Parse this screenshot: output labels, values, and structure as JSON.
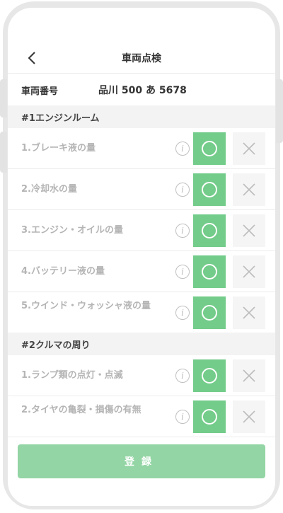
{
  "header": {
    "title": "車両点検"
  },
  "vehicle": {
    "label": "車両番号",
    "value": "品川 500 あ 5678"
  },
  "sections": [
    {
      "title": "#1エンジンルーム",
      "items": [
        {
          "label": "1.ブレーキ液の量"
        },
        {
          "label": "2.冷却水の量"
        },
        {
          "label": "3.エンジン・オイルの量"
        },
        {
          "label": "4.バッテリー液の量"
        },
        {
          "label": "5.ウインド・ウォッシャ液の量"
        }
      ]
    },
    {
      "title": "#2クルマの周り",
      "items": [
        {
          "label": "1.ランプ類の点灯・点滅"
        },
        {
          "label": "2.タイヤの亀裂・損傷の有無"
        }
      ]
    }
  ],
  "icons": {
    "info": "i"
  },
  "footer": {
    "register_label": "登録"
  },
  "colors": {
    "ok_green": "#73cc8a",
    "register_green": "#93d5a4",
    "ng_gray": "#f5f5f5"
  }
}
